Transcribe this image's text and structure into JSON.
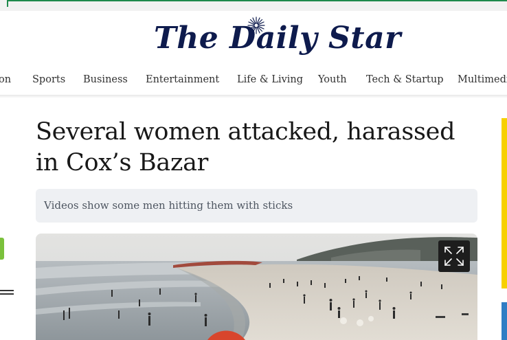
{
  "site": {
    "logo_text": "The Daily Star"
  },
  "nav": {
    "items": [
      {
        "label": "on"
      },
      {
        "label": "Sports"
      },
      {
        "label": "Business"
      },
      {
        "label": "Entertainment"
      },
      {
        "label": "Life & Living"
      },
      {
        "label": "Youth"
      },
      {
        "label": "Tech & Startup"
      },
      {
        "label": "Multimedia"
      }
    ]
  },
  "article": {
    "headline": "Several women attacked, harassed in Cox’s Bazar",
    "subheadline": "Videos show some men hitting them with sticks"
  },
  "icons": {
    "expand": "expand-icon",
    "menu": "hamburger-menu-icon",
    "logo_star": "star-icon"
  },
  "colors": {
    "brand_navy": "#0e1b4d",
    "accent_green": "#1f8a4c",
    "side_yellow": "#f7d000",
    "side_blue": "#2f7dc4",
    "side_lime": "#7bc13c"
  }
}
